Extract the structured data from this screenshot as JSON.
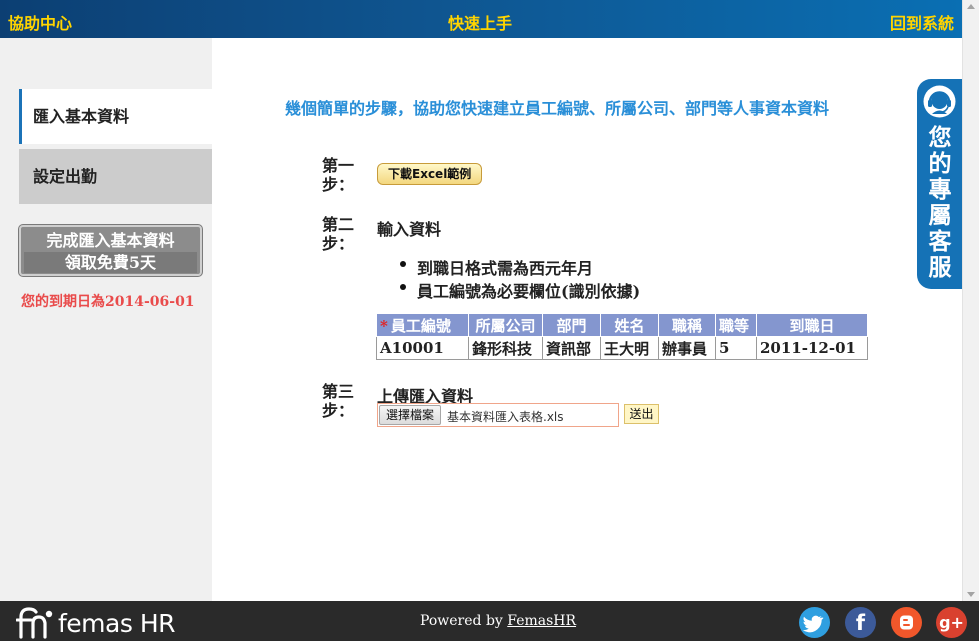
{
  "topbar": {
    "help_center": "協助中心",
    "quick_start": "快速上手",
    "back_to_system": "回到系統"
  },
  "sidebar": {
    "items": [
      {
        "label": "匯入基本資料",
        "active": true
      },
      {
        "label": "設定出勤",
        "active": false
      }
    ],
    "promo_line1": "完成匯入基本資料",
    "promo_line2": "領取免費5天",
    "expiry_text": "您的到期日為2014-06-01"
  },
  "main": {
    "heading": "幾個簡單的步驟，協助您快速建立員工編號、所屬公司、部門等人事資本資料",
    "step1": {
      "label": "第一步：",
      "button": "下載Excel範例"
    },
    "step2": {
      "label": "第二步：",
      "title": "輸入資料",
      "notes": [
        "到職日格式需為西元年月",
        "員工編號為必要欄位(識別依據)"
      ],
      "required_mark": "*",
      "table_headers": [
        "員工編號",
        "所屬公司",
        "部門",
        "姓名",
        "職稱",
        "職等",
        "到職日"
      ],
      "table_row": [
        "A10001",
        "鋒形科技",
        "資訊部",
        "王大明",
        "辦事員",
        "5",
        "2011-12-01"
      ]
    },
    "step3": {
      "label": "第三步：",
      "title": "上傳匯入資料",
      "choose_file": "選擇檔案",
      "file_name": "基本資料匯入表格.xls",
      "submit": "送出"
    }
  },
  "support_tab": {
    "text": "您的專屬客服",
    "icon": "headset-icon"
  },
  "footer": {
    "brand": "femas HR",
    "powered_prefix": "Powered by ",
    "powered_link": "FemasHR",
    "social": [
      "twitter-icon",
      "facebook-icon",
      "blogger-icon",
      "google-plus-icon"
    ]
  },
  "colors": {
    "topbar_text": "#ffd400",
    "heading_blue": "#2a8fd8",
    "table_header": "#8496cf",
    "expiry_red": "#e94b4b",
    "support_blue": "#1572b6"
  }
}
